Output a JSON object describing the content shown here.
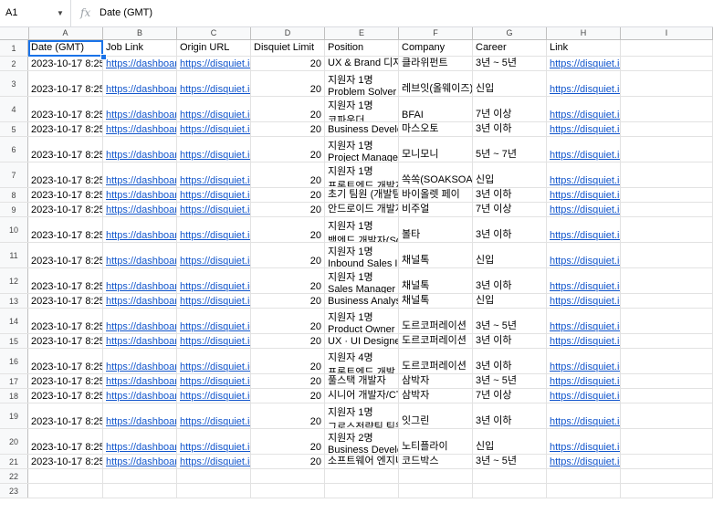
{
  "name_box": "A1",
  "formula_value": "Date (GMT)",
  "columns": [
    "A",
    "B",
    "C",
    "D",
    "E",
    "F",
    "G",
    "H",
    "I"
  ],
  "headers": [
    "Date (GMT)",
    "Job Link",
    "Origin URL",
    "Disquiet Limit",
    "Position",
    "Company",
    "Career",
    "Link",
    ""
  ],
  "rows": [
    {
      "n": "2",
      "date": "2023-10-17 8:25",
      "job": "https://dashboard",
      "origin": "https://disquiet.io",
      "limit": "20",
      "pos_top": "",
      "pos": "UX & Brand 디자",
      "company": "클라위펀트",
      "career": "3년 ~ 5년",
      "link": "https://disquiet.io/team/%ED%81%B4%"
    },
    {
      "n": "3",
      "date": "2023-10-17 8:25",
      "job": "https://dashboard",
      "origin": "https://disquiet.io",
      "limit": "20",
      "pos_top": "지원자 1명",
      "pos": "Problem Solver",
      "company": "레브잇(올웨이즈)",
      "career": "신입",
      "link": "https://disquiet.io/team/%EB%A0%89%"
    },
    {
      "n": "4",
      "date": "2023-10-17 8:25",
      "job": "https://dashboard",
      "origin": "https://disquiet.io",
      "limit": "20",
      "pos_top": "지원자 1명",
      "pos": "코파운더",
      "company": "BFAI",
      "career": "7년 이상",
      "link": "https://disquiet.io/team/bfai/jobs/%EC%"
    },
    {
      "n": "5",
      "date": "2023-10-17 8:25",
      "job": "https://dashboard",
      "origin": "https://disquiet.io",
      "limit": "20",
      "pos_top": "",
      "pos": "Business Develo",
      "company": "마스오토",
      "career": "3년 이하",
      "link": "https://disquiet.io/team/%EB%A7%88%"
    },
    {
      "n": "6",
      "date": "2023-10-17 8:25",
      "job": "https://dashboard",
      "origin": "https://disquiet.io",
      "limit": "20",
      "pos_top": "지원자 1명",
      "pos": "Project Manager",
      "company": "모니모니",
      "career": "5년 ~ 7년",
      "link": "https://disquiet.io/team/%EB%AA%A8%"
    },
    {
      "n": "7",
      "date": "2023-10-17 8:25",
      "job": "https://dashboard",
      "origin": "https://disquiet.io",
      "limit": "20",
      "pos_top": "지원자 1명",
      "pos": "프론트엔드 개발자",
      "company": "쏙쏙(SOAKSOAK",
      "career": "신입",
      "link": "https://disquiet.io/team/%EC%8F%99%"
    },
    {
      "n": "8",
      "date": "2023-10-17 8:25",
      "job": "https://dashboard",
      "origin": "https://disquiet.io",
      "limit": "20",
      "pos_top": "",
      "pos": "초기 팀원 (개발팀",
      "company": "바이올렛 페이",
      "career": "3년 이하",
      "link": "https://disquiet.io/team/%EB%B0%94%"
    },
    {
      "n": "9",
      "date": "2023-10-17 8:25",
      "job": "https://dashboard",
      "origin": "https://disquiet.io",
      "limit": "20",
      "pos_top": "",
      "pos": "안드로이드 개발자",
      "company": "비주얼",
      "career": "7년 이상",
      "link": "https://disquiet.io/team/%EB%B9%84%"
    },
    {
      "n": "10",
      "date": "2023-10-17 8:25",
      "job": "https://dashboard",
      "origin": "https://disquiet.io",
      "limit": "20",
      "pos_top": "지원자 1명",
      "pos": "백엔드 개발자(Sof",
      "company": "볼타",
      "career": "3년 이하",
      "link": "https://disquiet.io/team/bolta/jobs/%EB"
    },
    {
      "n": "11",
      "date": "2023-10-17 8:25",
      "job": "https://dashboard",
      "origin": "https://disquiet.io",
      "limit": "20",
      "pos_top": "지원자 1명",
      "pos": "Inbound Sales In",
      "company": "채널톡",
      "career": "신입",
      "link": "https://disquiet.io/team/%EC%B1%84%"
    },
    {
      "n": "12",
      "date": "2023-10-17 8:25",
      "job": "https://dashboard",
      "origin": "https://disquiet.io",
      "limit": "20",
      "pos_top": "지원자 1명",
      "pos": "Sales Manager",
      "company": "채널톡",
      "career": "3년 이하",
      "link": "https://disquiet.io/team/%EC%B1%84%"
    },
    {
      "n": "13",
      "date": "2023-10-17 8:25",
      "job": "https://dashboard",
      "origin": "https://disquiet.io",
      "limit": "20",
      "pos_top": "",
      "pos": "Business Analys",
      "company": "채널톡",
      "career": "신입",
      "link": "https://disquiet.io/team/%EC%B1%84%"
    },
    {
      "n": "14",
      "date": "2023-10-17 8:25",
      "job": "https://dashboard",
      "origin": "https://disquiet.io",
      "limit": "20",
      "pos_top": "지원자 1명",
      "pos": "Product Owner",
      "company": "도르코퍼레이션",
      "career": "3년 ~ 5년",
      "link": "https://disquiet.io/team/%EB%8F%84%"
    },
    {
      "n": "15",
      "date": "2023-10-17 8:25",
      "job": "https://dashboard",
      "origin": "https://disquiet.io",
      "limit": "20",
      "pos_top": "",
      "pos": "UX · UI Designe",
      "company": "도르코퍼레이션",
      "career": "3년 이하",
      "link": "https://disquiet.io/team/%EB%8F%84%"
    },
    {
      "n": "16",
      "date": "2023-10-17 8:25",
      "job": "https://dashboard",
      "origin": "https://disquiet.io",
      "limit": "20",
      "pos_top": "지원자 4명",
      "pos": "프론트엔드 개발",
      "company": "도르코퍼레이션",
      "career": "3년 이하",
      "link": "https://disquiet.io/team/%EB%8F%84%"
    },
    {
      "n": "17",
      "date": "2023-10-17 8:25",
      "job": "https://dashboard",
      "origin": "https://disquiet.io",
      "limit": "20",
      "pos_top": "",
      "pos": "풀스택 개발자",
      "company": "삼박자",
      "career": "3년 ~ 5년",
      "link": "https://disquiet.io/team/%EC%82%BC%"
    },
    {
      "n": "18",
      "date": "2023-10-17 8:25",
      "job": "https://dashboard",
      "origin": "https://disquiet.io",
      "limit": "20",
      "pos_top": "",
      "pos": "시니어 개발자/CTO",
      "company": "삼박자",
      "career": "7년 이상",
      "link": "https://disquiet.io/team/%EC%82%BC%"
    },
    {
      "n": "19",
      "date": "2023-10-17 8:25",
      "job": "https://dashboard",
      "origin": "https://disquiet.io",
      "limit": "20",
      "pos_top": "지원자 1명",
      "pos": "그로스전략팀 팀원",
      "company": "잇그린",
      "career": "3년 이하",
      "link": "https://disquiet.io/team/%EC%9E%87%"
    },
    {
      "n": "20",
      "date": "2023-10-17 8:25",
      "job": "https://dashboard",
      "origin": "https://disquiet.io",
      "limit": "20",
      "pos_top": "지원자 2명",
      "pos": "Business Develo",
      "company": "노티플라이",
      "career": "신입",
      "link": "https://disquiet.io/team/%EB%85%B8%"
    },
    {
      "n": "21",
      "date": "2023-10-17 8:25",
      "job": "https://dashboard",
      "origin": "https://disquiet.io",
      "limit": "20",
      "pos_top": "",
      "pos": "소프트웨어 엔지니",
      "company": "코드박스",
      "career": "3년 ~ 5년",
      "link": "https://disquiet.io/team/%EC%BD%94%"
    },
    {
      "n": "22",
      "date": "",
      "job": "",
      "origin": "",
      "limit": "",
      "pos_top": "",
      "pos": "",
      "company": "",
      "career": "",
      "link": ""
    },
    {
      "n": "23",
      "date": "",
      "job": "",
      "origin": "",
      "limit": "",
      "pos_top": "",
      "pos": "",
      "company": "",
      "career": "",
      "link": ""
    }
  ]
}
